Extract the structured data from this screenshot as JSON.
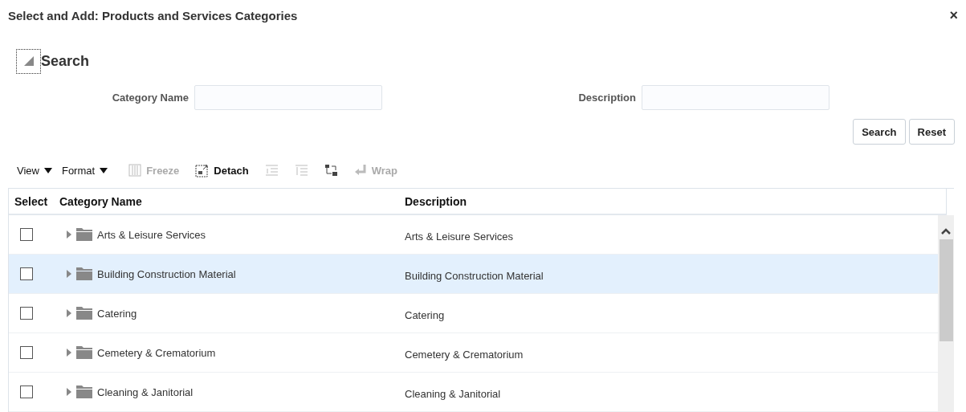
{
  "dialog": {
    "title": "Select and Add: Products and Services Categories",
    "close": "×"
  },
  "search": {
    "title": "Search",
    "expanded": true,
    "fields": [
      {
        "label": "Category Name"
      },
      {
        "label": "Description"
      }
    ],
    "buttons": [
      "Search",
      "Reset"
    ]
  },
  "toolbar": [
    {
      "kind": "menu",
      "label": "View",
      "disabled": false
    },
    {
      "kind": "menu",
      "label": "Format",
      "disabled": false
    },
    {
      "kind": "freeze",
      "label": "Freeze",
      "disabled": true
    },
    {
      "kind": "detach",
      "label": "Detach",
      "disabled": false
    },
    {
      "kind": "indent",
      "disabled": true
    },
    {
      "kind": "outdent",
      "disabled": true
    },
    {
      "kind": "hierarchy",
      "disabled": false
    },
    {
      "kind": "wrap",
      "label": "Wrap",
      "disabled": true
    }
  ],
  "table": {
    "columns": [
      "Select",
      "Category Name",
      "Description"
    ],
    "rows": [
      {
        "name": "Arts & Leisure Services",
        "description": "Arts & Leisure Services",
        "checked": false,
        "selected": false
      },
      {
        "name": "Building Construction Material",
        "description": "Building Construction Material",
        "checked": false,
        "selected": true
      },
      {
        "name": "Catering",
        "description": "Catering",
        "checked": false,
        "selected": false
      },
      {
        "name": "Cemetery & Crematorium",
        "description": "Cemetery & Crematorium",
        "checked": false,
        "selected": false
      },
      {
        "name": "Cleaning & Janitorial",
        "description": "Cleaning & Janitorial",
        "checked": false,
        "selected": false
      }
    ]
  }
}
